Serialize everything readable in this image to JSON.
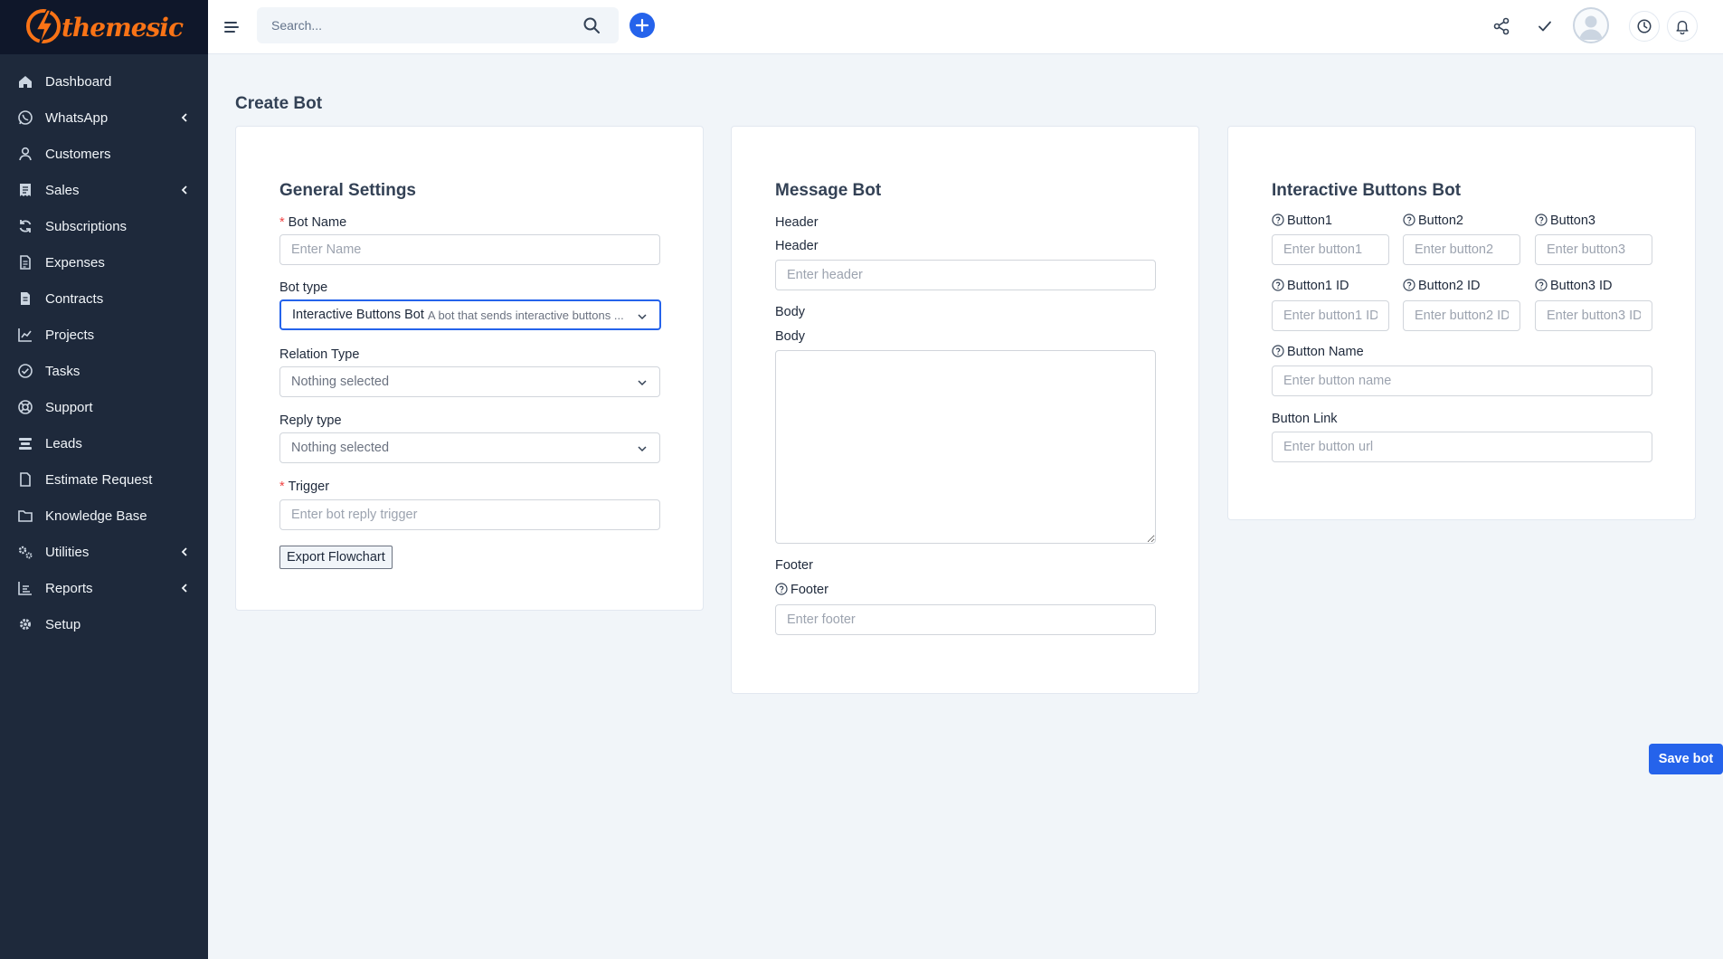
{
  "app": {
    "logo_text": "themesic"
  },
  "colors": {
    "sidebar": "#1e293b",
    "accent": "#2563eb",
    "brand": "#f97316",
    "required": "#ef4444"
  },
  "sidebar": {
    "items": [
      {
        "label": "Dashboard",
        "icon": "home-icon",
        "has_submenu": false
      },
      {
        "label": "WhatsApp",
        "icon": "whatsapp-icon",
        "has_submenu": true
      },
      {
        "label": "Customers",
        "icon": "user-icon",
        "has_submenu": false
      },
      {
        "label": "Sales",
        "icon": "receipt-icon",
        "has_submenu": true
      },
      {
        "label": "Subscriptions",
        "icon": "refresh-icon",
        "has_submenu": false
      },
      {
        "label": "Expenses",
        "icon": "document-icon",
        "has_submenu": false
      },
      {
        "label": "Contracts",
        "icon": "contract-icon",
        "has_submenu": false
      },
      {
        "label": "Projects",
        "icon": "chart-icon",
        "has_submenu": false
      },
      {
        "label": "Tasks",
        "icon": "check-circle-icon",
        "has_submenu": false
      },
      {
        "label": "Support",
        "icon": "lifebuoy-icon",
        "has_submenu": false
      },
      {
        "label": "Leads",
        "icon": "funnel-icon",
        "has_submenu": false
      },
      {
        "label": "Estimate Request",
        "icon": "file-icon",
        "has_submenu": false
      },
      {
        "label": "Knowledge Base",
        "icon": "folder-icon",
        "has_submenu": false
      },
      {
        "label": "Utilities",
        "icon": "cogs-icon",
        "has_submenu": true
      },
      {
        "label": "Reports",
        "icon": "bar-chart-icon",
        "has_submenu": true
      },
      {
        "label": "Setup",
        "icon": "gear-icon",
        "has_submenu": false
      }
    ]
  },
  "topbar": {
    "search_placeholder": "Search..."
  },
  "page": {
    "title": "Create Bot",
    "save_label": "Save bot"
  },
  "general": {
    "heading": "General Settings",
    "bot_name_label": "Bot Name",
    "bot_name_placeholder": "Enter Name",
    "bot_type_label": "Bot type",
    "bot_type_value": "Interactive Buttons Bot",
    "bot_type_desc": "A bot that sends interactive buttons ...",
    "relation_label": "Relation Type",
    "relation_value": "Nothing selected",
    "reply_label": "Reply type",
    "reply_value": "Nothing selected",
    "trigger_label": "Trigger",
    "trigger_placeholder": "Enter bot reply trigger",
    "export_label": "Export Flowchart"
  },
  "message": {
    "heading": "Message Bot",
    "header_section": "Header",
    "header_label": "Header",
    "header_placeholder": "Enter header",
    "body_section": "Body",
    "body_label": "Body",
    "footer_section": "Footer",
    "footer_label": "Footer",
    "footer_placeholder": "Enter footer"
  },
  "interactive": {
    "heading": "Interactive Buttons Bot",
    "button1_label": "Button1",
    "button1_placeholder": "Enter button1",
    "button2_label": "Button2",
    "button2_placeholder": "Enter button2",
    "button3_label": "Button3",
    "button3_placeholder": "Enter button3",
    "button1_id_label": "Button1 ID",
    "button1_id_placeholder": "Enter button1 ID",
    "button2_id_label": "Button2 ID",
    "button2_id_placeholder": "Enter button2 ID",
    "button3_id_label": "Button3 ID",
    "button3_id_placeholder": "Enter button3 ID",
    "button_name_label": "Button Name",
    "button_name_placeholder": "Enter button name",
    "button_link_label": "Button Link",
    "button_link_placeholder": "Enter button url"
  }
}
